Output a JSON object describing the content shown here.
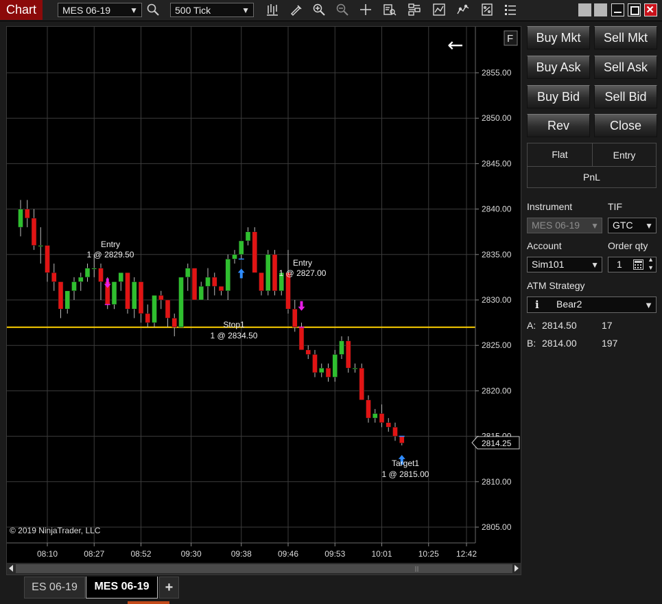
{
  "app": {
    "title": "Chart"
  },
  "toolbar": {
    "instrument": "MES 06-19",
    "interval": "500 Tick",
    "icons": [
      "search-icon",
      "bar-type-icon",
      "drawing-pencil-icon",
      "zoom-in-icon",
      "zoom-out-icon",
      "crosshair-icon",
      "data-box-icon",
      "indicators-icon",
      "strategies-icon",
      "chart-trader-icon",
      "properties-icon",
      "list-icon"
    ]
  },
  "window": {
    "controls": [
      "restore-icon",
      "restore2-icon",
      "minimize-icon",
      "maximize-icon",
      "close-icon"
    ]
  },
  "chart": {
    "price_labels": [
      "2855.00",
      "2850.00",
      "2845.00",
      "2840.00",
      "2835.00",
      "2830.00",
      "2825.00",
      "2820.00",
      "2815.00",
      "2810.00",
      "2805.00"
    ],
    "time_labels": [
      "08:10",
      "08:27",
      "08:52",
      "09:30",
      "09:38",
      "09:46",
      "09:53",
      "10:01",
      "10:25",
      "12:42"
    ],
    "current_price": "2814.25",
    "copyright": "© 2019 NinjaTrader, LLC",
    "float_button": "F",
    "back_arrow": "←",
    "colors": {
      "up": "#2fbf2f",
      "down": "#e01414",
      "hline": "#ffd000",
      "grid": "#3c3c3c"
    },
    "annotations": [
      {
        "line1": "Entry",
        "line2": "1 @ 2829.50"
      },
      {
        "line1": "Entry",
        "line2": "1 @ 2827.00"
      },
      {
        "line1": "Stop1",
        "line2": "1 @ 2834.50"
      },
      {
        "line1": "Target1",
        "line2": "1 @ 2815.00"
      }
    ]
  },
  "chart_data": {
    "type": "candlestick",
    "instrument": "MES 06-19",
    "ylim": [
      2803,
      2858
    ],
    "yticks": [
      2805,
      2810,
      2815,
      2820,
      2825,
      2830,
      2835,
      2840,
      2845,
      2850,
      2855
    ],
    "horizontal_line": 2827,
    "candles": [
      {
        "o": 2838,
        "h": 2841,
        "c": 2840,
        "l": 2837
      },
      {
        "o": 2840,
        "h": 2841,
        "c": 2839,
        "l": 2838
      },
      {
        "o": 2839,
        "h": 2840,
        "c": 2836,
        "l": 2835.5
      },
      {
        "o": 2836,
        "h": 2838,
        "c": 2836,
        "l": 2834
      },
      {
        "o": 2836,
        "h": 2836,
        "c": 2833,
        "l": 2832
      },
      {
        "o": 2833,
        "h": 2834,
        "c": 2832,
        "l": 2831
      },
      {
        "o": 2832,
        "h": 2832,
        "c": 2829,
        "l": 2828
      },
      {
        "o": 2829,
        "h": 2831,
        "c": 2831,
        "l": 2828.5
      },
      {
        "o": 2831,
        "h": 2832.5,
        "c": 2832,
        "l": 2830
      },
      {
        "o": 2832,
        "h": 2833,
        "c": 2832.5,
        "l": 2831
      },
      {
        "o": 2832.5,
        "h": 2834,
        "c": 2833.5,
        "l": 2832
      },
      {
        "o": 2833.5,
        "h": 2835,
        "c": 2833.5,
        "l": 2832.5
      },
      {
        "o": 2833.5,
        "h": 2834,
        "c": 2832,
        "l": 2830
      },
      {
        "o": 2832,
        "h": 2832.5,
        "c": 2829.5,
        "l": 2829
      },
      {
        "o": 2829.5,
        "h": 2832,
        "c": 2832,
        "l": 2829
      },
      {
        "o": 2832,
        "h": 2833,
        "c": 2833,
        "l": 2831
      },
      {
        "o": 2833,
        "h": 2833,
        "c": 2829,
        "l": 2828.5
      },
      {
        "o": 2829,
        "h": 2832.5,
        "c": 2832,
        "l": 2828
      },
      {
        "o": 2832,
        "h": 2832,
        "c": 2828.5,
        "l": 2827.5
      },
      {
        "o": 2828.5,
        "h": 2829.5,
        "c": 2827.5,
        "l": 2827
      },
      {
        "o": 2827.5,
        "h": 2830.5,
        "c": 2830.5,
        "l": 2827
      },
      {
        "o": 2830.5,
        "h": 2831,
        "c": 2830,
        "l": 2829
      },
      {
        "o": 2830,
        "h": 2830,
        "c": 2828,
        "l": 2827
      },
      {
        "o": 2828,
        "h": 2828.5,
        "c": 2827,
        "l": 2826
      },
      {
        "o": 2827,
        "h": 2832.5,
        "c": 2832.5,
        "l": 2827
      },
      {
        "o": 2832.5,
        "h": 2834,
        "c": 2833.5,
        "l": 2831
      },
      {
        "o": 2833.5,
        "h": 2833.5,
        "c": 2830,
        "l": 2830
      },
      {
        "o": 2830,
        "h": 2832,
        "c": 2831.5,
        "l": 2830
      },
      {
        "o": 2831.5,
        "h": 2833.5,
        "c": 2832.5,
        "l": 2830
      },
      {
        "o": 2832.5,
        "h": 2833,
        "c": 2831.5,
        "l": 2830.5
      },
      {
        "o": 2831.5,
        "h": 2831.5,
        "c": 2831,
        "l": 2830.5
      },
      {
        "o": 2831,
        "h": 2835,
        "c": 2834.5,
        "l": 2830
      },
      {
        "o": 2834.5,
        "h": 2835.5,
        "c": 2835,
        "l": 2834
      },
      {
        "o": 2835,
        "h": 2836.5,
        "c": 2836.5,
        "l": 2834.5
      },
      {
        "o": 2836.5,
        "h": 2838,
        "c": 2837.5,
        "l": 2836
      },
      {
        "o": 2837.5,
        "h": 2838,
        "c": 2833,
        "l": 2833
      },
      {
        "o": 2833,
        "h": 2833,
        "c": 2831,
        "l": 2830.5
      },
      {
        "o": 2831,
        "h": 2835.5,
        "c": 2835,
        "l": 2830.5
      },
      {
        "o": 2835,
        "h": 2835.5,
        "c": 2831,
        "l": 2830.5
      },
      {
        "o": 2831,
        "h": 2833,
        "c": 2833,
        "l": 2830.5
      },
      {
        "o": 2833,
        "h": 2835.5,
        "c": 2829,
        "l": 2828.5
      },
      {
        "o": 2829,
        "h": 2830,
        "c": 2827,
        "l": 2826.5
      },
      {
        "o": 2827,
        "h": 2827.5,
        "c": 2824.5,
        "l": 2824.5
      },
      {
        "o": 2824.5,
        "h": 2825,
        "c": 2824,
        "l": 2823.5
      },
      {
        "o": 2824,
        "h": 2824.5,
        "c": 2822,
        "l": 2821.5
      },
      {
        "o": 2822,
        "h": 2823,
        "c": 2822.5,
        "l": 2821.5
      },
      {
        "o": 2822.5,
        "h": 2823,
        "c": 2821.5,
        "l": 2821
      },
      {
        "o": 2821.5,
        "h": 2824.5,
        "c": 2824,
        "l": 2821
      },
      {
        "o": 2824,
        "h": 2826,
        "c": 2825.5,
        "l": 2823.5
      },
      {
        "o": 2825.5,
        "h": 2826,
        "c": 2822.5,
        "l": 2822
      },
      {
        "o": 2822.5,
        "h": 2823,
        "c": 2822.5,
        "l": 2822
      },
      {
        "o": 2822.5,
        "h": 2823,
        "c": 2819,
        "l": 2819
      },
      {
        "o": 2819,
        "h": 2819.5,
        "c": 2817,
        "l": 2816.5
      },
      {
        "o": 2817,
        "h": 2818,
        "c": 2817.5,
        "l": 2816.5
      },
      {
        "o": 2817.5,
        "h": 2818.5,
        "c": 2816.5,
        "l": 2816
      },
      {
        "o": 2816.5,
        "h": 2817,
        "c": 2816,
        "l": 2815.5
      },
      {
        "o": 2816,
        "h": 2816.5,
        "c": 2815,
        "l": 2814.5
      },
      {
        "o": 2815,
        "h": 2815,
        "c": 2814.25,
        "l": 2814
      }
    ],
    "entry_markers": [
      {
        "bar": 13,
        "price": 2829.5
      },
      {
        "bar": 42,
        "price": 2827.0
      }
    ],
    "exit_markers": [
      {
        "bar": 33,
        "price": 2834.5
      },
      {
        "bar": 57,
        "price": 2815.0
      }
    ]
  },
  "trader": {
    "buttons": [
      "Buy Mkt",
      "Sell Mkt",
      "Buy Ask",
      "Sell Ask",
      "Buy Bid",
      "Sell Bid",
      "Rev",
      "Close"
    ],
    "pnl": {
      "flat": "Flat",
      "entry": "Entry",
      "pnl": "PnL"
    },
    "instrument_label": "Instrument",
    "tif_label": "TIF",
    "instrument_value": "MES 06-19",
    "tif_value": "GTC",
    "account_label": "Account",
    "qty_label": "Order qty",
    "account_value": "Sim101",
    "qty_value": "1",
    "atm_label": "ATM Strategy",
    "atm_info": "i",
    "atm_value": "Bear2",
    "ask": {
      "label": "A:",
      "price": "2814.50",
      "size": "17"
    },
    "bid": {
      "label": "B:",
      "price": "2814.00",
      "size": "197"
    }
  },
  "tabs": [
    {
      "label": "ES 06-19",
      "active": false
    },
    {
      "label": "MES 06-19",
      "active": true
    }
  ],
  "add_tab": "+"
}
